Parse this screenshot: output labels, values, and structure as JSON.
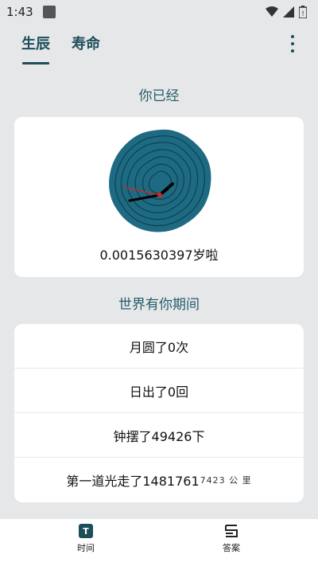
{
  "status_bar": {
    "time": "1:43"
  },
  "tabs": [
    {
      "label": "生辰"
    },
    {
      "label": "寿命"
    }
  ],
  "sections": {
    "lived_title": "你已经",
    "world_title": "世界有你期间"
  },
  "age": {
    "value_text": "0.0015630397岁啦"
  },
  "stats": {
    "moon": "月圆了0次",
    "sunrise": "日出了0回",
    "pendulum": "钟摆了49426下",
    "light_main": "第一道光走了1481761",
    "light_tail": "7423 公 里"
  },
  "bottom_nav": {
    "time_label": "时间",
    "answer_label": "答案",
    "time_icon_letter": "T"
  },
  "colors": {
    "accent": "#1c4e5a",
    "clock_face": "#1d6a82",
    "background": "#e6e7e8"
  }
}
